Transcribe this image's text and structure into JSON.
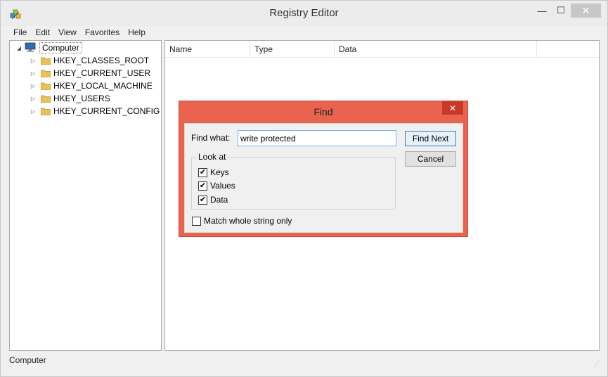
{
  "window": {
    "title": "Registry Editor",
    "minimize_glyph": "—",
    "maximize_glyph": "☐",
    "close_glyph": "✕"
  },
  "menu": [
    "File",
    "Edit",
    "View",
    "Favorites",
    "Help"
  ],
  "tree": {
    "root": "Computer",
    "keys": [
      "HKEY_CLASSES_ROOT",
      "HKEY_CURRENT_USER",
      "HKEY_LOCAL_MACHINE",
      "HKEY_USERS",
      "HKEY_CURRENT_CONFIG"
    ]
  },
  "list": {
    "columns": [
      "Name",
      "Type",
      "Data"
    ]
  },
  "status": {
    "path": "Computer"
  },
  "find_dialog": {
    "title": "Find",
    "close_glyph": "✕",
    "find_what_label": "Find what:",
    "find_what_value": "write protected",
    "find_next_label": "Find Next",
    "cancel_label": "Cancel",
    "look_at_label": "Look at",
    "options": [
      {
        "label": "Keys",
        "checked": true
      },
      {
        "label": "Values",
        "checked": true
      },
      {
        "label": "Data",
        "checked": true
      }
    ],
    "match_whole_label": "Match whole string only",
    "match_whole_checked": false
  },
  "colors": {
    "dialog_frame": "#e9634f",
    "dialog_close": "#c8392a",
    "window_bg": "#f0f0f0"
  }
}
